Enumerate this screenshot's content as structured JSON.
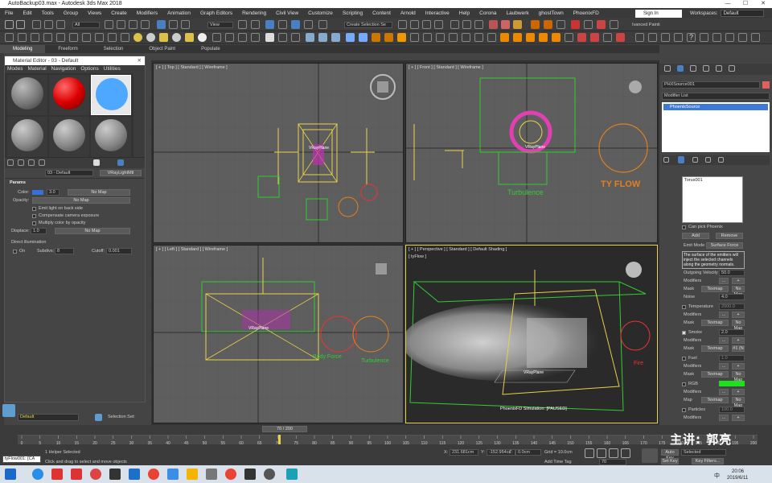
{
  "window": {
    "title": "AutoBackup03.max - Autodesk 3ds Max 2018",
    "minimize": "—",
    "maximize": "☐",
    "close": "✕"
  },
  "menu": [
    "File",
    "Edit",
    "Tools",
    "Group",
    "Views",
    "Create",
    "Modifiers",
    "Animation",
    "Graph Editors",
    "Rendering",
    "Civil View",
    "Customize",
    "Scripting",
    "Content",
    "Arnold",
    "Interactive",
    "Help",
    "Corona",
    "Laubwerk",
    "ghostTown",
    "PhoenixFD"
  ],
  "signin": {
    "label": "Sign In"
  },
  "workspaces": {
    "label": "Workspaces:",
    "value": "Default"
  },
  "toolbar": {
    "filter": "All",
    "view": "View",
    "selection_set": "Create Selection Se",
    "vanced": "Ivanced Painti"
  },
  "ribbon_tabs": [
    "Modeling",
    "Freeform",
    "Selection",
    "Object Paint",
    "Populate"
  ],
  "material_editor": {
    "title": "Material Editor - 03 - Default",
    "menu": [
      "Modes",
      "Material",
      "Navigation",
      "Options",
      "Utilities"
    ],
    "name": "03 - Default",
    "type": "VRayLightMtl",
    "params_header": "Params",
    "color_label": "Color:",
    "color_value": "3.0",
    "color_map": "No Map",
    "opacity_label": "Opacity:",
    "opacity_map": "No Map",
    "emit_back": "Emit light on back side",
    "comp_exposure": "Compensate camera exposure",
    "mult_opacity": "Multiply color by opacity",
    "displace_label": "Displace:",
    "displace_value": "1.0",
    "displace_map": "No Map",
    "direct_illum": "Direct illumination",
    "on_label": "On",
    "subdivs_label": "Subdivs:",
    "subdivs_value": "8",
    "cutoff_label": "Cutoff:",
    "cutoff_value": "0.001"
  },
  "viewports": {
    "top": "[ + ] [ Top ] [ Standard ] [ Wireframe ]",
    "front": "[ + ] [ Front ] [ Standard ] [ Wireframe ]",
    "left": "[ + ] [ Left ] [ Standard ] [ Wireframe ]",
    "perspective": "[ + ] [ Perspective ] [ Standard ] [ Default Shading ]",
    "tyflow_label": "[ tyFlow ]",
    "labels": {
      "vrayplane": "VRayPlane",
      "turbulence": "Turbulence",
      "body_force": "Body Force",
      "fire": "Fire",
      "tyflow_logo": "TY FLOW",
      "sim_status": "PhoenixFD Simulation: [PAUSED]"
    }
  },
  "command_panel": {
    "object_name": "PHXSource001",
    "modifier_list": "Modifier List",
    "stack_item": "PhoenixSource",
    "emitter_list_item": "Torus001",
    "can_pick": "Can pick Phoenix",
    "add": "Add",
    "remove": "Remove",
    "emit_mode_label": "Emit Mode",
    "emit_mode_value": "Surface Force",
    "note": "The surface of the emitters will inject the selected channels along the geometry normals.",
    "rows": [
      {
        "label": "Outgoing Velocity",
        "value": "50.0"
      },
      {
        "label": "Modifiers",
        "value": "..."
      },
      {
        "label": "Mask",
        "value": "Texmap"
      },
      {
        "label": "Noise",
        "value": "4.0"
      },
      {
        "label": "Temperature",
        "value": "2000.0"
      },
      {
        "label": "Modifiers",
        "value": "..."
      },
      {
        "label": "Mask",
        "value": "Texmap"
      },
      {
        "label": "Smoke",
        "value": "2.0"
      },
      {
        "label": "Modifiers",
        "value": "..."
      },
      {
        "label": "Mask",
        "value": "Texmap"
      },
      {
        "label": "Fuel",
        "value": "1.0"
      },
      {
        "label": "Modifiers",
        "value": "..."
      },
      {
        "label": "Mask",
        "value": "Texmap"
      },
      {
        "label": "RGB",
        "value": ""
      },
      {
        "label": "Modifiers",
        "value": "..."
      },
      {
        "label": "Map",
        "value": "Texmap"
      },
      {
        "label": "Particles",
        "value": "100.0"
      },
      {
        "label": "Modifiers",
        "value": "..."
      }
    ],
    "nomap": "No Map",
    "mask_hash": "#1 (N"
  },
  "status": {
    "layer": "Default",
    "selection_set_label": "Selection Set:",
    "frame": "70 / 200",
    "helper_selected": "1 Helper Selected",
    "hint": "Click and drag to select and move objects",
    "script": "tyFlow001: [CA",
    "x_label": "X:",
    "x_value": "231.681cm",
    "y_label": "Y:",
    "y_value": "-152.954cr",
    "z_label": "Z:",
    "z_value": "0.0cm",
    "grid": "Grid = 10.0cm",
    "add_time_tag": "Add Time Tag",
    "auto_key": "Auto Key",
    "selected": "Selected",
    "set_key": "Set Key",
    "key_filters": "Key Filters...",
    "current_frame": "70",
    "ticks": [
      "0",
      "5",
      "10",
      "15",
      "20",
      "25",
      "30",
      "35",
      "40",
      "45",
      "50",
      "55",
      "60",
      "65",
      "70",
      "75",
      "80",
      "85",
      "90",
      "95",
      "100",
      "105",
      "110",
      "115",
      "120",
      "125",
      "130",
      "135",
      "140",
      "145",
      "150",
      "155",
      "160",
      "165",
      "170",
      "175",
      "180",
      "185",
      "190",
      "195",
      "200"
    ]
  },
  "watermark": "主讲: 郭亮",
  "taskbar": {
    "time": "20:06",
    "date": "2019/6/11",
    "lang": "中"
  }
}
